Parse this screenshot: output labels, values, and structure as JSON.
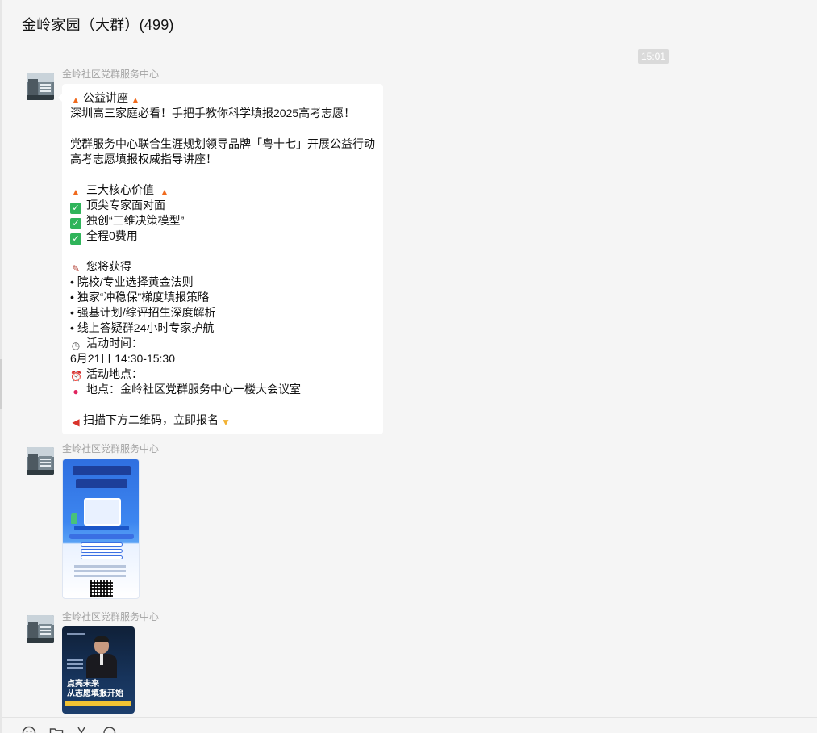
{
  "window": {
    "title": "金岭家园（大群）(499)"
  },
  "chat": {
    "time_badge": "15:01",
    "messages": [
      {
        "sender": "金岭社区党群服务中心",
        "type": "text",
        "lines": [
          "公益讲座",
          "深圳高三家庭必看！手把手教你科学填报2025高考志愿！",
          "",
          "党群服务中心联合生涯规划领导品牌「粤十七」开展公益行动",
          " 高考志愿填报权威指导讲座！",
          "",
          "三大核心价值",
          "顶尖专家面对面",
          "独创“三维决策模型”",
          "全程0费用",
          "",
          "您将获得",
          "• 院校/专业选择黄金法则",
          "• 独家“冲稳保”梯度填报策略",
          "• 强基计划/综评招生深度解析",
          "• 线上答疑群24小时专家护航",
          "活动时间：",
          "6月21日 14:30-15:30",
          "活动地点：",
          "地点：金岭社区党群服务中心一楼大会议室",
          "",
          "扫描下方二维码，立即报名"
        ]
      },
      {
        "sender": "金岭社区党群服务中心",
        "type": "image"
      },
      {
        "sender": "金岭社区党群服务中心",
        "type": "image",
        "caption_line1": "点亮未来",
        "caption_line2": "从志愿填报开始"
      }
    ]
  },
  "icons": {
    "fire": "fire-icon",
    "check": "check-mark-icon",
    "memo": "memo-icon",
    "clock": "clock-icon",
    "alarm": "alarm-clock-icon",
    "pin": "pin-icon",
    "horn": "megaphone-icon",
    "hand": "pointing-down-icon"
  },
  "toolbar": {
    "items": [
      "emoji-icon",
      "folder-icon",
      "scissors-icon",
      "chat-history-icon"
    ]
  },
  "colors": {
    "background": "#f5f5f5",
    "bubble": "#ffffff",
    "check": "#2fb45a",
    "fire": "#f06a1d"
  }
}
